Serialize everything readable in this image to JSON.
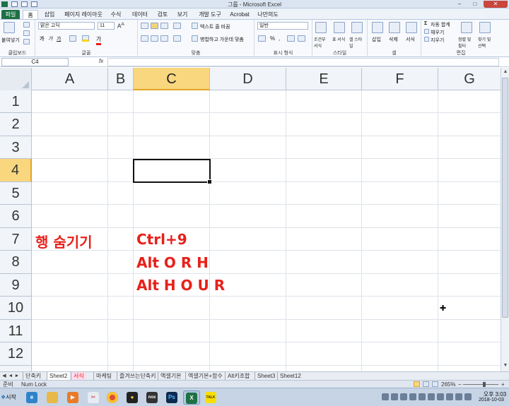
{
  "window": {
    "title": "그룹 - Microsoft Excel"
  },
  "tabs": [
    "파일",
    "홈",
    "삽입",
    "페이지 레이아웃",
    "수식",
    "데이터",
    "검토",
    "보기",
    "개발 도구",
    "Acrobat",
    "나만의도"
  ],
  "ribbon": {
    "clipboard": {
      "label": "클립보드",
      "paste": "붙여넣기"
    },
    "font": {
      "label": "글꼴",
      "name": "맑은 고딕",
      "size": "11"
    },
    "alignment": {
      "label": "맞춤",
      "wrap": "텍스트 줄 바꿈",
      "merge": "병합하고 가운데 맞춤"
    },
    "number": {
      "label": "표시 형식",
      "format": "일반"
    },
    "styles": {
      "label": "스타일",
      "conditional": "조건부 서식",
      "table": "표 서식",
      "cell_styles": "셀 스타일"
    },
    "cells": {
      "label": "셀",
      "insert": "삽입",
      "delete": "삭제",
      "format": "서식"
    },
    "editing": {
      "label": "편집",
      "autosum": "자동 합계",
      "fill": "채우기",
      "clear": "지우기",
      "sort": "정렬 및 필터",
      "find": "찾기 및 선택"
    }
  },
  "formula_bar": {
    "name_box": "C4",
    "fx": "fx",
    "value": ""
  },
  "columns": [
    "A",
    "B",
    "C",
    "D",
    "E",
    "F",
    "G"
  ],
  "rows": [
    "1",
    "2",
    "3",
    "4",
    "5",
    "6",
    "7",
    "8",
    "9",
    "10",
    "11",
    "12"
  ],
  "active_cell": "C4",
  "cells": {
    "A7": "행 숨기기",
    "C7": "Ctrl+9",
    "C8": "Alt O R H",
    "C9": "Alt H O U R"
  },
  "sheet_tabs": [
    "단축키",
    "Sheet2",
    "서식",
    "마케팅",
    "즐겨쓰는단축키",
    "엑셀기본",
    "엑셀기본+함수",
    "Alt키조합",
    "Sheet3",
    "Sheet12"
  ],
  "status": {
    "mode": "준비",
    "num_lock": "Num Lock",
    "zoom": "265%"
  },
  "taskbar": {
    "start": "시작",
    "time": "오후 3:03",
    "date": "2018-10-03"
  },
  "colors": {
    "accent_text": "#e8201a",
    "selected_header": "#f9d77e",
    "file_tab": "#1e7145"
  }
}
